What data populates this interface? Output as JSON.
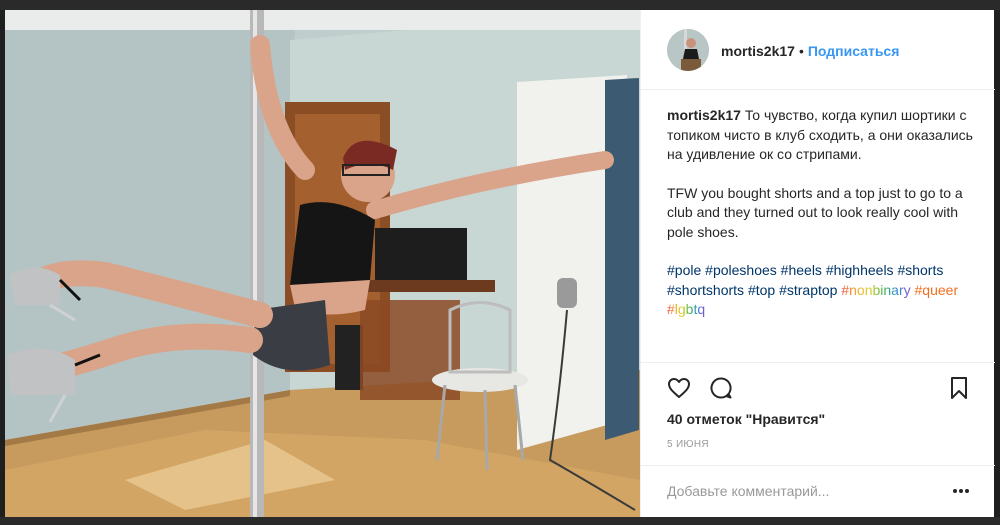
{
  "post": {
    "author": "mortis2k17",
    "separator": "•",
    "follow_label": "Подписаться",
    "caption": {
      "author": "mortis2k17",
      "text_ru": " То чувство, когда купил шортики с топиком чисто в клуб сходить, а они оказались на удивление ок со стрипами.",
      "text_en": "TFW you bought shorts and a top just to go to a club and they turned out to look really cool with pole shoes."
    },
    "hashtags": [
      {
        "text": "#pole",
        "style": "blue"
      },
      {
        "text": "#poleshoes",
        "style": "blue"
      },
      {
        "text": "#heels",
        "style": "blue"
      },
      {
        "text": "#highheels",
        "style": "blue"
      },
      {
        "text": "#shorts",
        "style": "blue"
      },
      {
        "text": "#shortshorts",
        "style": "blue"
      },
      {
        "text": "#top",
        "style": "blue"
      },
      {
        "text": "#straptop",
        "style": "blue"
      },
      {
        "text": "#nonbinary",
        "style": "rainbow"
      },
      {
        "text": "#queer",
        "style": "orange"
      },
      {
        "text": "#lgbtq",
        "style": "rainbow"
      }
    ],
    "likes": "40 отметок \"Нравится\"",
    "date": "5 июня",
    "comment_placeholder": "Добавьте комментарий...",
    "icons": {
      "like": "heart-icon",
      "comment": "comment-bubble-icon",
      "save": "bookmark-icon",
      "more": "more-options-icon"
    }
  },
  "colors": {
    "link_blue": "#3897f0",
    "hashtag": "#003569",
    "text": "#262626",
    "muted": "#999999"
  }
}
